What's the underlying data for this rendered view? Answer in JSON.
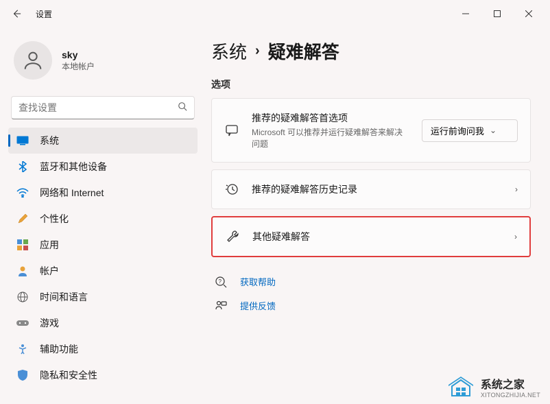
{
  "titlebar": {
    "title": "设置"
  },
  "profile": {
    "name": "sky",
    "subtitle": "本地帐户"
  },
  "search": {
    "placeholder": "查找设置"
  },
  "nav": {
    "items": [
      {
        "label": "系统",
        "icon": "display"
      },
      {
        "label": "蓝牙和其他设备",
        "icon": "bluetooth"
      },
      {
        "label": "网络和 Internet",
        "icon": "wifi"
      },
      {
        "label": "个性化",
        "icon": "brush"
      },
      {
        "label": "应用",
        "icon": "apps"
      },
      {
        "label": "帐户",
        "icon": "person"
      },
      {
        "label": "时间和语言",
        "icon": "globe"
      },
      {
        "label": "游戏",
        "icon": "gamepad"
      },
      {
        "label": "辅助功能",
        "icon": "access"
      },
      {
        "label": "隐私和安全性",
        "icon": "shield"
      }
    ]
  },
  "breadcrumb": {
    "parent": "系统",
    "current": "疑难解答"
  },
  "section": {
    "options": "选项"
  },
  "cards": {
    "recommended": {
      "title": "推荐的疑难解答首选项",
      "subtitle": "Microsoft 可以推荐并运行疑难解答来解决问题",
      "select": "运行前询问我"
    },
    "history": {
      "title": "推荐的疑难解答历史记录"
    },
    "other": {
      "title": "其他疑难解答"
    }
  },
  "links": {
    "help": "获取帮助",
    "feedback": "提供反馈"
  },
  "watermark": {
    "cn": "系统之家",
    "en": "XITONGZHIJIA.NET"
  }
}
